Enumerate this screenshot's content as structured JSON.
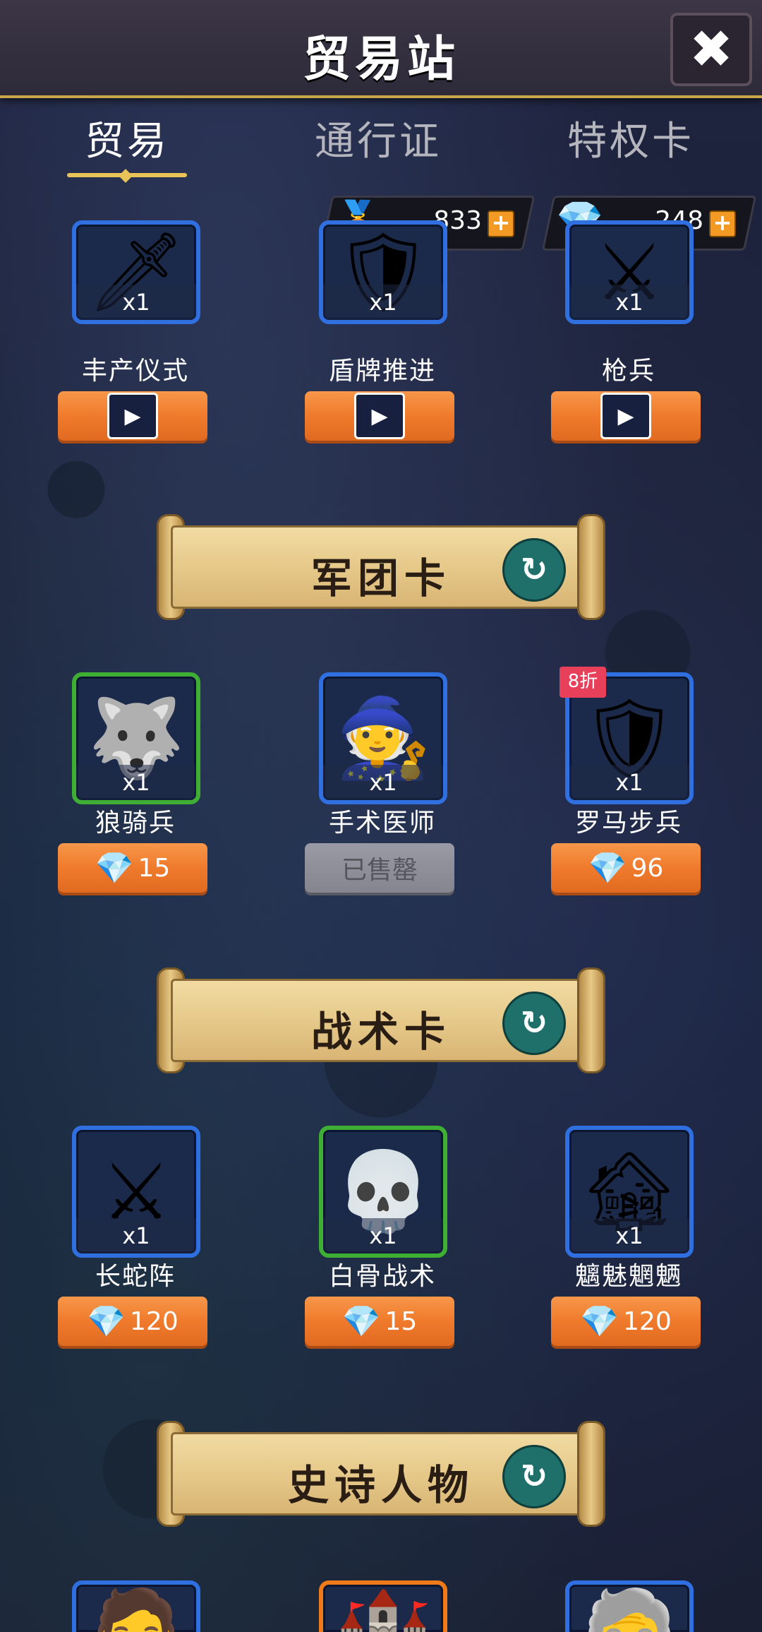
{
  "header": {
    "title": "贸易站",
    "close_icon": "✖"
  },
  "tabs": [
    {
      "label": "贸易"
    },
    {
      "label": "通行证"
    },
    {
      "label": "特权卡"
    }
  ],
  "currency": {
    "medal": {
      "icon": "medal-icon",
      "glyph": "🏅",
      "value": "833",
      "plus": "+"
    },
    "gem": {
      "icon": "gem-icon",
      "glyph": "💎",
      "value": "248",
      "plus": "+"
    }
  },
  "top_items": [
    {
      "name": "丰产仪式",
      "qty": "x1",
      "art": "🗡",
      "price_type": "video"
    },
    {
      "name": "盾牌推进",
      "qty": "x1",
      "art": "🛡",
      "price_type": "video"
    },
    {
      "name": "枪兵",
      "qty": "x1",
      "art": "⚔",
      "price_type": "video"
    }
  ],
  "sections": [
    {
      "title": "军团卡",
      "items": [
        {
          "name": "狼骑兵",
          "qty": "x1",
          "art": "🐺",
          "price": "15",
          "frame": "green"
        },
        {
          "name": "手术医师",
          "qty": "x1",
          "art": "🧙",
          "price": "已售罄",
          "sold": true,
          "frame": "blue"
        },
        {
          "name": "罗马步兵",
          "qty": "x1",
          "art": "🛡",
          "price": "96",
          "frame": "blue",
          "badge": "8折"
        }
      ]
    },
    {
      "title": "战术卡",
      "items": [
        {
          "name": "长蛇阵",
          "qty": "x1",
          "art": "⚔",
          "price": "120",
          "frame": "blue"
        },
        {
          "name": "白骨战术",
          "qty": "x1",
          "art": "💀",
          "price": "15",
          "frame": "green"
        },
        {
          "name": "魑魅魍魉",
          "qty": "x1",
          "art": "🏚",
          "price": "120",
          "frame": "blue"
        }
      ]
    },
    {
      "title": "史诗人物",
      "items": [
        {
          "art": "🧔",
          "frame": "blue"
        },
        {
          "art": "🏰",
          "frame": "orange"
        },
        {
          "art": "🧓",
          "frame": "blue"
        }
      ]
    }
  ],
  "icons": {
    "gem_glyph": "💎",
    "refresh_glyph": "↻",
    "video_glyph": "▶"
  },
  "colors": {
    "accent_gold": "#e8c358",
    "button_orange": "#f07a2c",
    "frame_blue": "#2f6fe0",
    "frame_green": "#3fae34",
    "banner_paper": "#e6c98a",
    "refresh_teal": "#1f6f6a",
    "badge_red": "#e8405a"
  }
}
